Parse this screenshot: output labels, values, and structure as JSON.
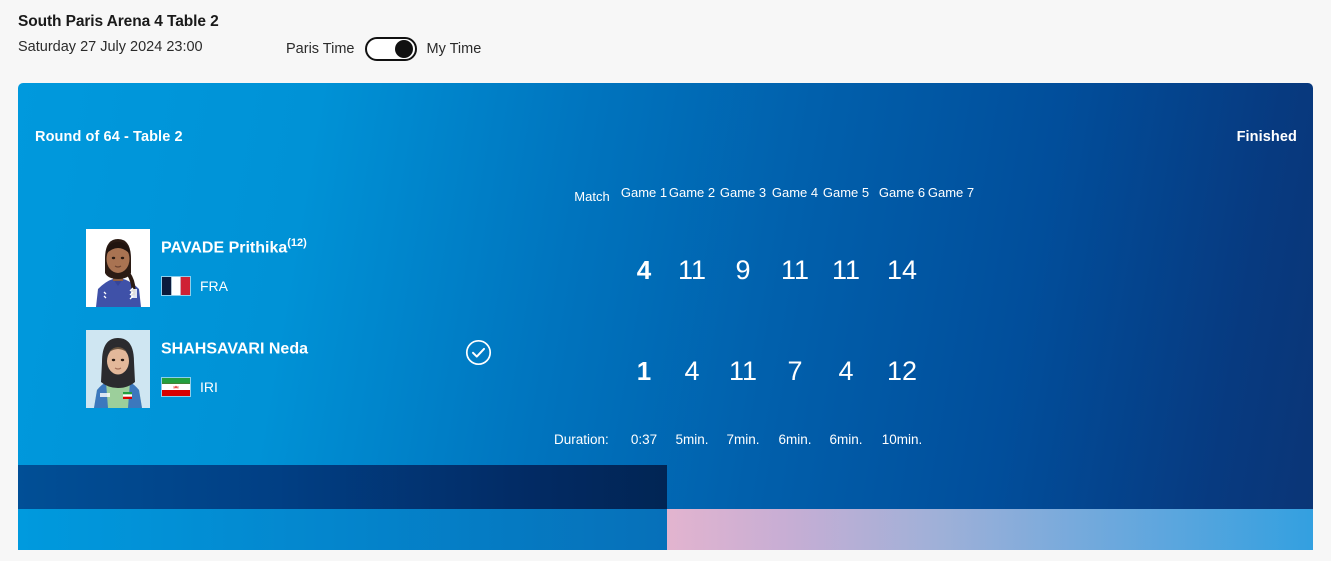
{
  "header": {
    "venue_title": "South Paris Arena 4 Table 2",
    "datetime": "Saturday 27 July 2024 23:00",
    "timezone_left_label": "Paris Time",
    "timezone_right_label": "My Time",
    "toggle_state": "my-time"
  },
  "card": {
    "round_label": "Round of 64 - Table 2",
    "status": "Finished",
    "duration_label": "Duration:",
    "accent_colors": {
      "card_start": "#0099dd",
      "card_end": "#0b3576",
      "band_dark": "#012554",
      "band_light": "#009ade",
      "band_accent_pink": "#e3b4cf",
      "band_accent_blue": "#33a0e0",
      "text": "#ffffff"
    }
  },
  "columns": [
    {
      "id": "match",
      "label": "Match"
    },
    {
      "id": "game1",
      "label": "Game 1"
    },
    {
      "id": "game2",
      "label": "Game 2"
    },
    {
      "id": "game3",
      "label": "Game 3"
    },
    {
      "id": "game4",
      "label": "Game 4"
    },
    {
      "id": "game5",
      "label": "Game 5"
    },
    {
      "id": "game6",
      "label": "Game 6"
    },
    {
      "id": "game7",
      "label": "Game 7"
    }
  ],
  "players": [
    {
      "name": "PAVADE Prithika",
      "seed": "(12)",
      "country_code": "FRA",
      "flag": "flag-fra",
      "photo": "player-photo-pavade",
      "is_winner": true,
      "winner_icon": "check-circle-icon",
      "match_score": "4",
      "games": [
        "11",
        "9",
        "11",
        "11",
        "14",
        ""
      ]
    },
    {
      "name": "SHAHSAVARI Neda",
      "seed": "",
      "country_code": "IRI",
      "flag": "flag-iri",
      "photo": "player-photo-shahsavari",
      "is_winner": false,
      "winner_icon": "",
      "match_score": "1",
      "games": [
        "4",
        "11",
        "7",
        "4",
        "12",
        ""
      ]
    }
  ],
  "durations": [
    "0:37",
    "5min.",
    "7min.",
    "6min.",
    "6min.",
    "10min.",
    ""
  ]
}
